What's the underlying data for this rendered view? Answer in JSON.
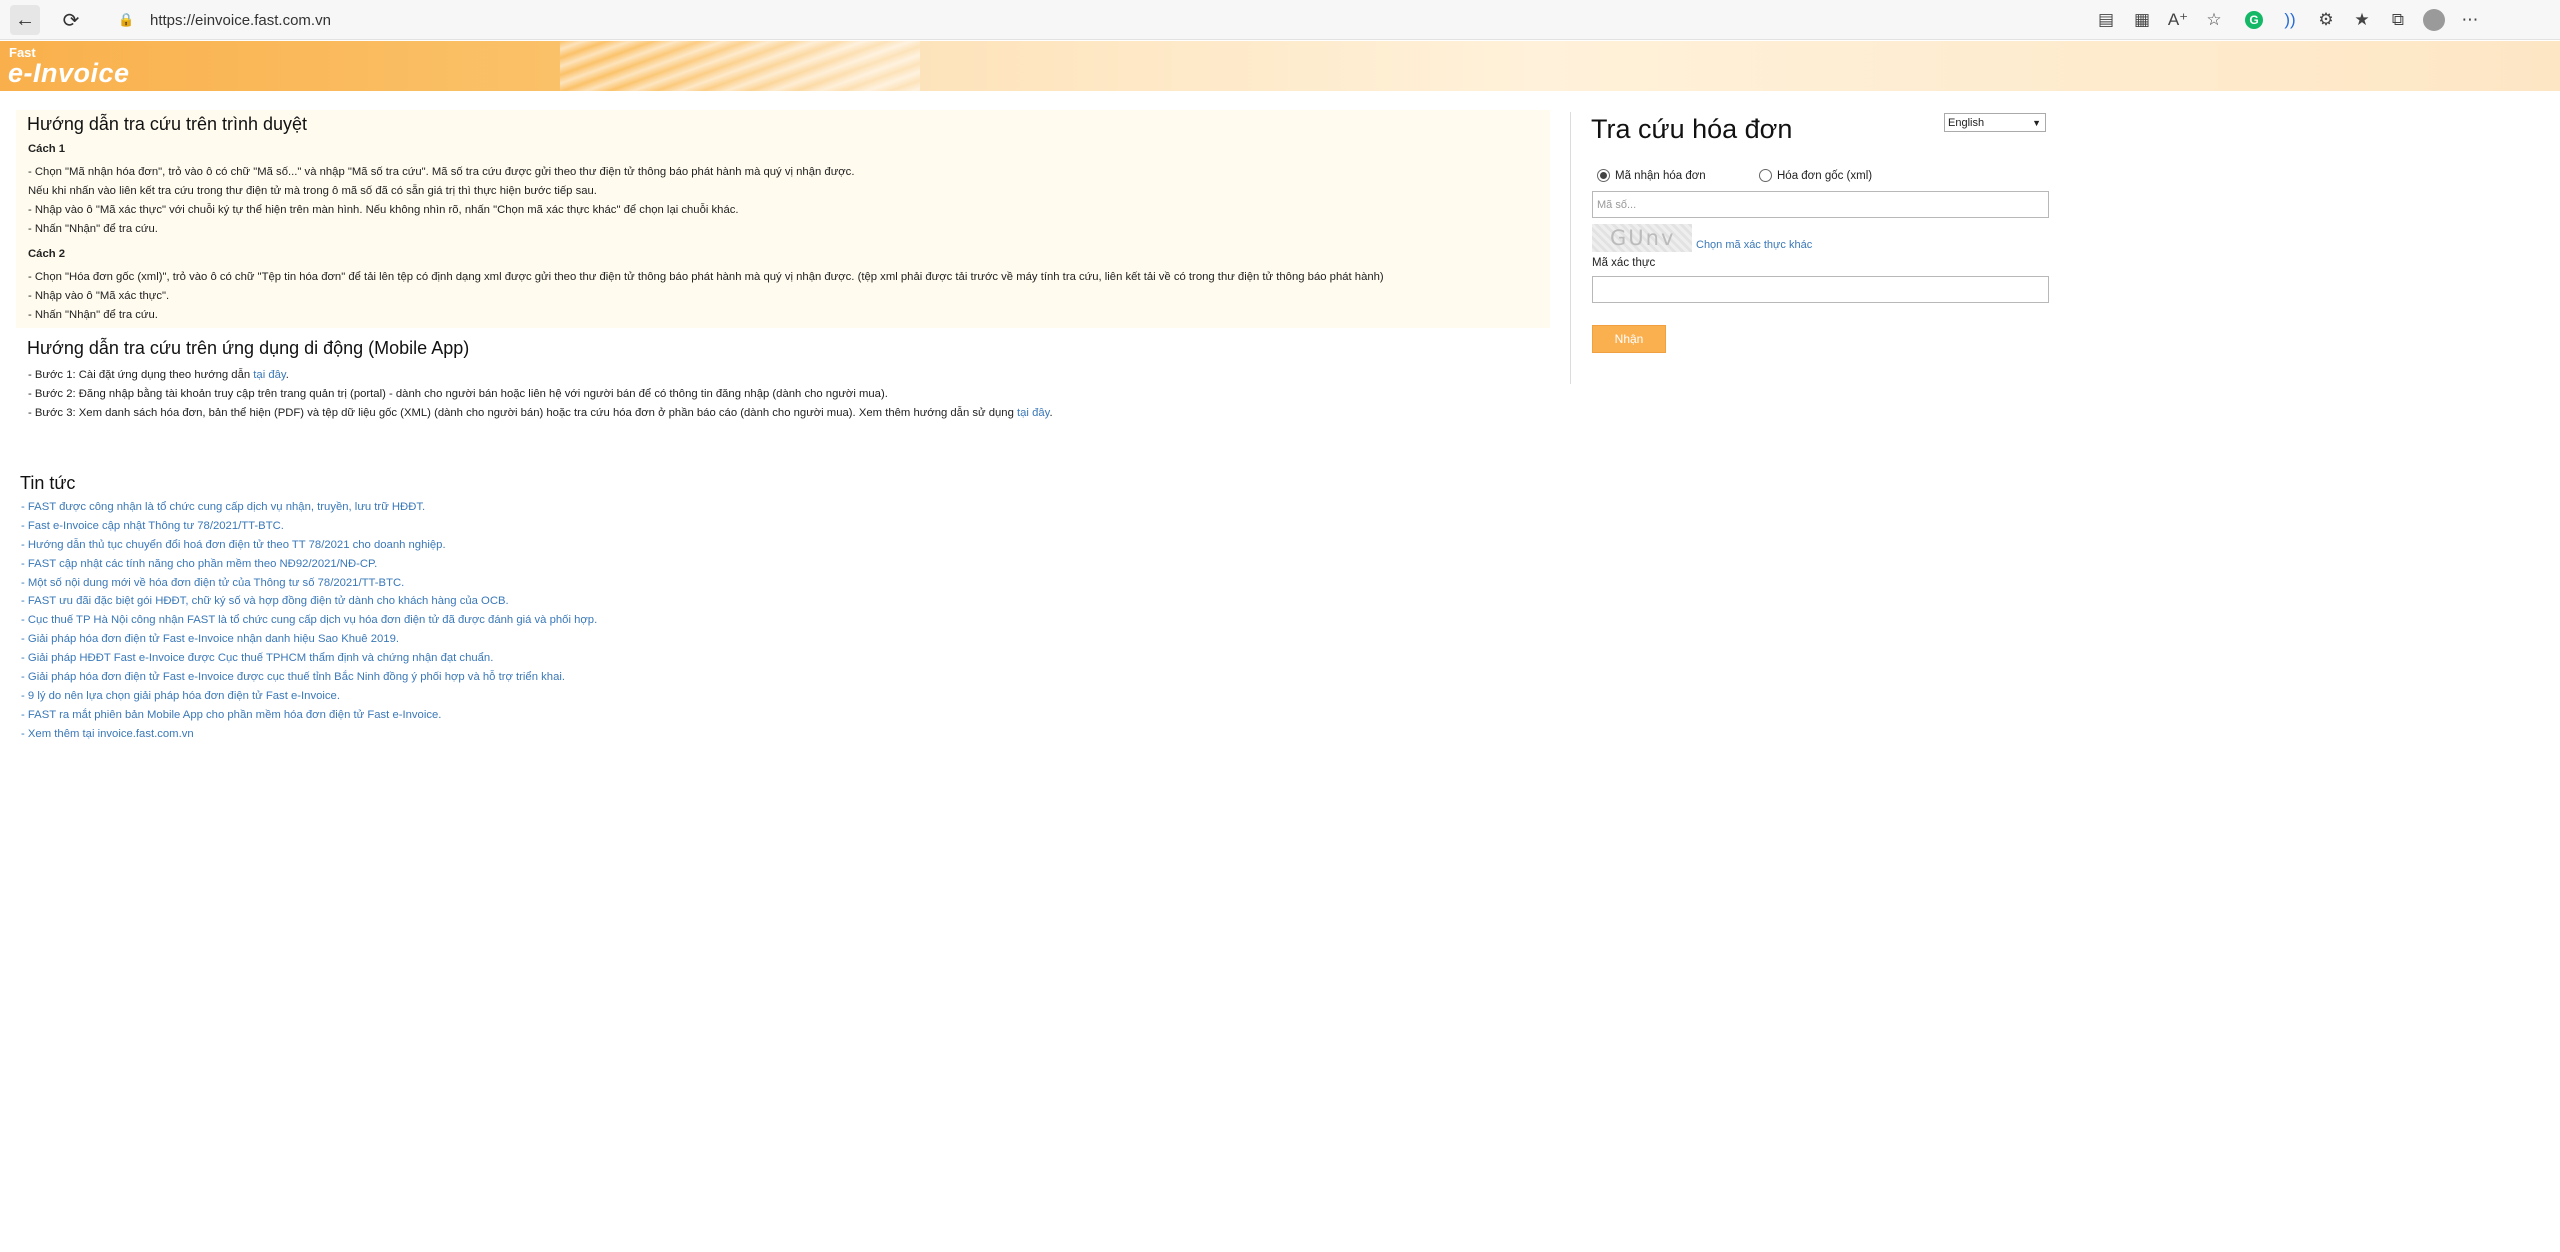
{
  "browser": {
    "url": "https://einvoice.fast.com.vn",
    "icons": [
      "back-icon",
      "reload-icon",
      "lock-icon",
      "reading-view-icon",
      "qr-icon",
      "read-aloud-icon",
      "favorite-add-icon",
      "grammarly-icon",
      "audio-icon",
      "extensions-icon",
      "favorites-icon",
      "collections-icon",
      "profile-icon",
      "more-icon"
    ]
  },
  "banner": {
    "logo_small": "Fast",
    "logo_big": "e-Invoice"
  },
  "guide": {
    "browser_title": "Hướng dẫn tra cứu trên trình duyệt",
    "method1_title": "Cách 1",
    "method1_lines": [
      "- Chọn \"Mã nhận hóa đơn\", trỏ vào ô có chữ \"Mã số...\" và nhập \"Mã số tra cứu\". Mã số tra cứu được gửi theo thư điện tử thông báo phát hành mà quý vị nhận được.",
      "Nếu khi nhấn vào liên kết tra cứu trong thư điện tử mà trong ô mã số đã có sẵn giá trị thì thực hiện bước tiếp sau.",
      "- Nhập vào ô \"Mã xác thực\" với chuỗi ký tự thể hiện trên màn hình. Nếu không nhìn rõ, nhấn \"Chọn mã xác thực khác\" để chọn lại chuỗi khác.",
      "- Nhấn \"Nhận\" để tra cứu."
    ],
    "method2_title": "Cách 2",
    "method2_lines": [
      "- Chọn \"Hóa đơn gốc (xml)\", trỏ vào ô có chữ \"Tệp tin hóa đơn\" để tải lên tệp có định dạng xml được gửi theo thư điện tử thông báo phát hành mà quý vị nhận được. (tệp xml phải được tải trước về máy tính tra cứu, liên kết tải về có trong thư điện tử thông báo phát hành)",
      "- Nhập vào ô \"Mã xác thực\".",
      "- Nhấn \"Nhận\" để tra cứu."
    ]
  },
  "mobile": {
    "title": "Hướng dẫn tra cứu trên ứng dụng di động (Mobile App)",
    "step1_text": "- Bước 1: Cài đặt ứng dụng theo hướng dẫn ",
    "step1_link": "tại đây",
    "step1_end": ".",
    "step2_text": "- Bước 2: Đăng nhập bằng tài khoản truy cập trên trang quản trị (portal) - dành cho người bán hoặc liên hệ với người bán để có thông tin đăng nhập (dành cho người mua).",
    "step3_text": "- Bước 3: Xem danh sách hóa đơn, bản thể hiện (PDF) và tệp dữ liệu gốc (XML) (dành cho người bán) hoặc tra cứu hóa đơn ở phần báo cáo (dành cho người mua). Xem thêm hướng dẫn sử dụng ",
    "step3_link": "tại đây",
    "step3_end": "."
  },
  "news": {
    "title": "Tin tức",
    "items": [
      "- FAST được công nhận là tổ chức cung cấp dịch vụ nhận, truyền, lưu trữ HĐĐT.",
      "- Fast e-Invoice cập nhật Thông tư 78/2021/TT-BTC.",
      "- Hướng dẫn thủ tục chuyển đổi hoá đơn điện tử theo TT 78/2021 cho doanh nghiệp.",
      "- FAST cập nhật các tính năng cho phần mềm theo NĐ92/2021/NĐ-CP.",
      "- Một số nội dung mới về hóa đơn điện tử của Thông tư số 78/2021/TT-BTC.",
      "- FAST ưu đãi đặc biệt gói HĐĐT, chữ ký số và hợp đồng điện tử dành cho khách hàng của OCB.",
      "- Cục thuế TP Hà Nội công nhận FAST là tổ chức cung cấp dịch vụ hóa đơn điện tử đã được đánh giá và phối hợp.",
      "- Giải pháp hóa đơn điện tử Fast e-Invoice nhận danh hiệu Sao Khuê 2019.",
      "- Giải pháp HĐĐT Fast e-Invoice được Cục thuế TPHCM thẩm định và chứng nhận đạt chuẩn.",
      "- Giải pháp hóa đơn điện tử Fast e-Invoice được cục thuế tỉnh Bắc Ninh đồng ý phối hợp và hỗ trợ triển khai.",
      "- 9 lý do nên lựa chọn giải pháp hóa đơn điện tử Fast e-Invoice.",
      "- FAST ra mắt phiên bản Mobile App cho phần mềm hóa đơn điện tử Fast e-Invoice.",
      "- Xem thêm tại invoice.fast.com.vn"
    ]
  },
  "form": {
    "title": "Tra cứu hóa đơn",
    "language": "English",
    "radio1_label": "Mã nhận hóa đơn",
    "radio2_label": "Hóa đơn gốc (xml)",
    "code_placeholder": "Mã số...",
    "captcha_text": "GUnv",
    "captcha_link": "Chọn mã xác thực khác",
    "auth_label": "Mã xác thực",
    "submit_label": "Nhận"
  }
}
